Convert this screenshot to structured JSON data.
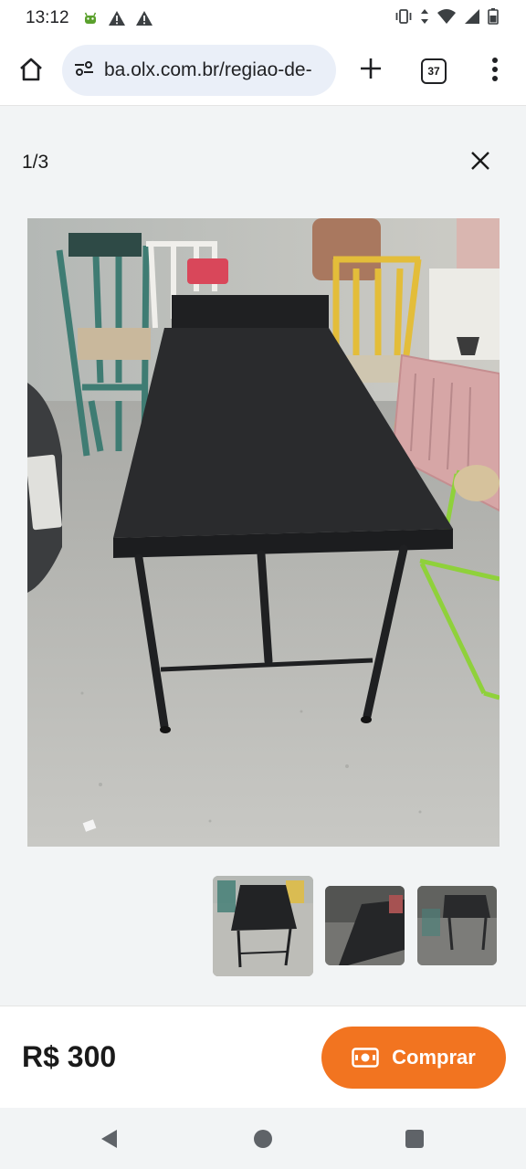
{
  "status_bar": {
    "time": "13:12",
    "icons": [
      "android-debug-icon",
      "warning-icon",
      "warning-icon",
      "vibrate-icon",
      "data-arrows-icon",
      "wifi-icon",
      "signal-icon",
      "battery-icon"
    ]
  },
  "browser": {
    "url": "ba.olx.com.br/regiao-de-",
    "tab_count": "37",
    "icons": [
      "home-icon",
      "site-settings-icon",
      "plus-icon",
      "tabs-icon",
      "kebab-menu-icon"
    ]
  },
  "gallery": {
    "counter": "1/3",
    "close_icon": "close-icon",
    "photo_subject": "black folding massage table in garage",
    "thumbnails_count": 3,
    "selected_thumbnail": 1
  },
  "listing": {
    "price": "R$ 300",
    "buy_label": "Comprar",
    "buy_icon": "money-icon"
  },
  "colors": {
    "accent": "#f27420",
    "url_bar_bg": "#eaeff8",
    "page_bg": "#f2f4f5"
  },
  "nav_bar": {
    "icons": [
      "back-icon",
      "home-circle-icon",
      "recents-icon"
    ]
  }
}
